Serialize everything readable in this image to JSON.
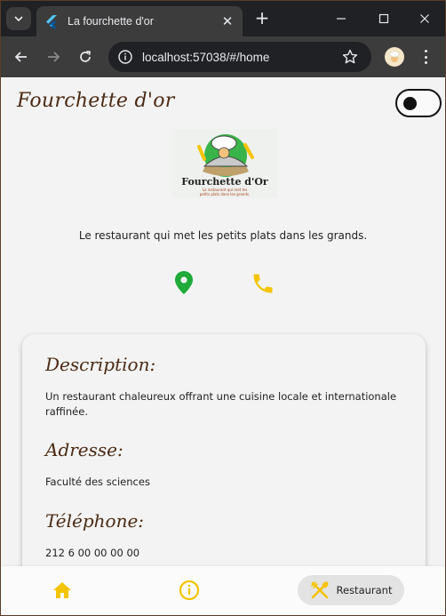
{
  "browser": {
    "tab_title": "La fourchette d'or",
    "url": "localhost:57038/#/home"
  },
  "app": {
    "brand": "Fourchette d'or",
    "logo": {
      "title": "Fourchette d'Or",
      "subtitle_line1": "Le restaurant qui met les",
      "subtitle_line2": "petits plats dans les grands."
    },
    "tagline": "Le restaurant qui met les petits plats dans les grands.",
    "sections": {
      "description": {
        "title": "Description:",
        "text": "Un restaurant chaleureux offrant une cuisine locale et internationale raffinée."
      },
      "address": {
        "title": "Adresse:",
        "text": "Faculté des sciences"
      },
      "phone": {
        "title": "Téléphone:",
        "text": "212 6 00 00 00 00"
      }
    },
    "bottom_nav": {
      "restaurant_label": "Restaurant"
    },
    "colors": {
      "brown": "#4b2a14",
      "green_pin": "#1faa3a",
      "amber": "#f5c400"
    }
  }
}
